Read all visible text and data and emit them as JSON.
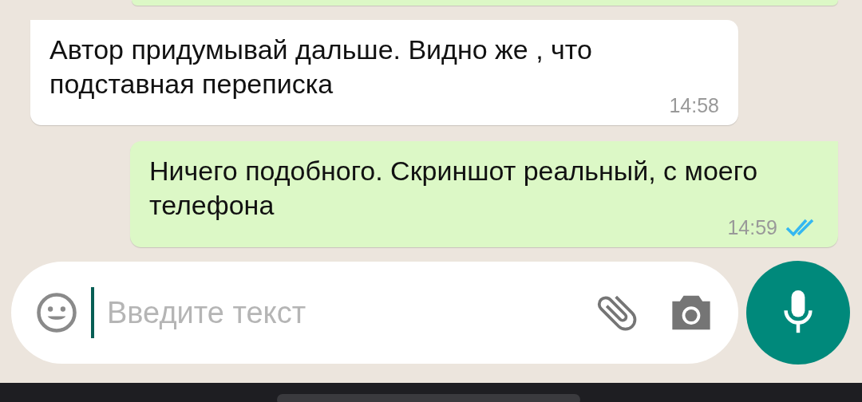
{
  "messages": [
    {
      "kind": "incoming",
      "text": "Автор придумывай дальше. Видно же , что подставная переписка",
      "time": "14:58"
    },
    {
      "kind": "outgoing",
      "text": "Ничего подобного. Скриншот реальный, с моего телефона",
      "time": "14:59",
      "read": true
    }
  ],
  "composer": {
    "placeholder": "Введите текст"
  }
}
